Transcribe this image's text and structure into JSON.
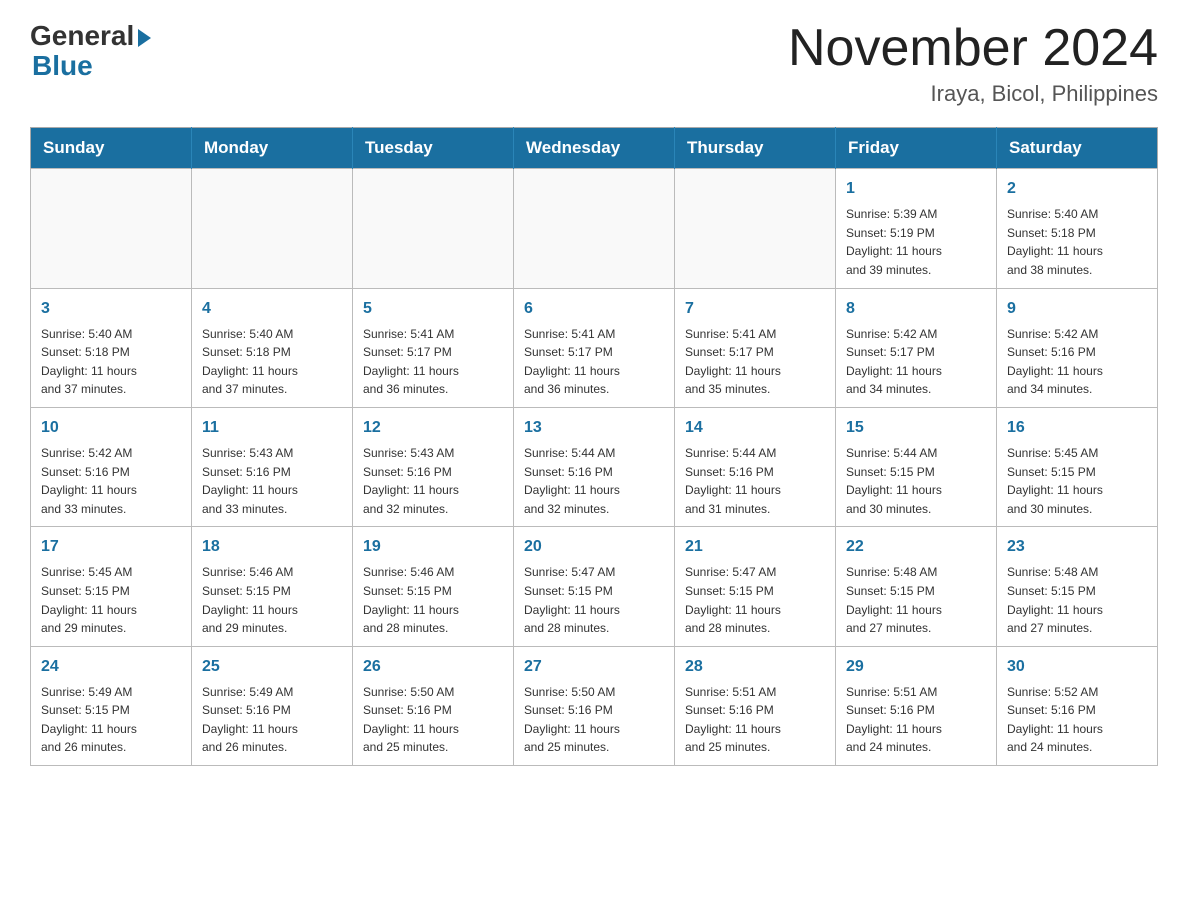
{
  "header": {
    "logo_general": "General",
    "logo_blue": "Blue",
    "month_title": "November 2024",
    "location": "Iraya, Bicol, Philippines"
  },
  "weekdays": [
    "Sunday",
    "Monday",
    "Tuesday",
    "Wednesday",
    "Thursday",
    "Friday",
    "Saturday"
  ],
  "weeks": [
    [
      {
        "day": "",
        "info": ""
      },
      {
        "day": "",
        "info": ""
      },
      {
        "day": "",
        "info": ""
      },
      {
        "day": "",
        "info": ""
      },
      {
        "day": "",
        "info": ""
      },
      {
        "day": "1",
        "info": "Sunrise: 5:39 AM\nSunset: 5:19 PM\nDaylight: 11 hours\nand 39 minutes."
      },
      {
        "day": "2",
        "info": "Sunrise: 5:40 AM\nSunset: 5:18 PM\nDaylight: 11 hours\nand 38 minutes."
      }
    ],
    [
      {
        "day": "3",
        "info": "Sunrise: 5:40 AM\nSunset: 5:18 PM\nDaylight: 11 hours\nand 37 minutes."
      },
      {
        "day": "4",
        "info": "Sunrise: 5:40 AM\nSunset: 5:18 PM\nDaylight: 11 hours\nand 37 minutes."
      },
      {
        "day": "5",
        "info": "Sunrise: 5:41 AM\nSunset: 5:17 PM\nDaylight: 11 hours\nand 36 minutes."
      },
      {
        "day": "6",
        "info": "Sunrise: 5:41 AM\nSunset: 5:17 PM\nDaylight: 11 hours\nand 36 minutes."
      },
      {
        "day": "7",
        "info": "Sunrise: 5:41 AM\nSunset: 5:17 PM\nDaylight: 11 hours\nand 35 minutes."
      },
      {
        "day": "8",
        "info": "Sunrise: 5:42 AM\nSunset: 5:17 PM\nDaylight: 11 hours\nand 34 minutes."
      },
      {
        "day": "9",
        "info": "Sunrise: 5:42 AM\nSunset: 5:16 PM\nDaylight: 11 hours\nand 34 minutes."
      }
    ],
    [
      {
        "day": "10",
        "info": "Sunrise: 5:42 AM\nSunset: 5:16 PM\nDaylight: 11 hours\nand 33 minutes."
      },
      {
        "day": "11",
        "info": "Sunrise: 5:43 AM\nSunset: 5:16 PM\nDaylight: 11 hours\nand 33 minutes."
      },
      {
        "day": "12",
        "info": "Sunrise: 5:43 AM\nSunset: 5:16 PM\nDaylight: 11 hours\nand 32 minutes."
      },
      {
        "day": "13",
        "info": "Sunrise: 5:44 AM\nSunset: 5:16 PM\nDaylight: 11 hours\nand 32 minutes."
      },
      {
        "day": "14",
        "info": "Sunrise: 5:44 AM\nSunset: 5:16 PM\nDaylight: 11 hours\nand 31 minutes."
      },
      {
        "day": "15",
        "info": "Sunrise: 5:44 AM\nSunset: 5:15 PM\nDaylight: 11 hours\nand 30 minutes."
      },
      {
        "day": "16",
        "info": "Sunrise: 5:45 AM\nSunset: 5:15 PM\nDaylight: 11 hours\nand 30 minutes."
      }
    ],
    [
      {
        "day": "17",
        "info": "Sunrise: 5:45 AM\nSunset: 5:15 PM\nDaylight: 11 hours\nand 29 minutes."
      },
      {
        "day": "18",
        "info": "Sunrise: 5:46 AM\nSunset: 5:15 PM\nDaylight: 11 hours\nand 29 minutes."
      },
      {
        "day": "19",
        "info": "Sunrise: 5:46 AM\nSunset: 5:15 PM\nDaylight: 11 hours\nand 28 minutes."
      },
      {
        "day": "20",
        "info": "Sunrise: 5:47 AM\nSunset: 5:15 PM\nDaylight: 11 hours\nand 28 minutes."
      },
      {
        "day": "21",
        "info": "Sunrise: 5:47 AM\nSunset: 5:15 PM\nDaylight: 11 hours\nand 28 minutes."
      },
      {
        "day": "22",
        "info": "Sunrise: 5:48 AM\nSunset: 5:15 PM\nDaylight: 11 hours\nand 27 minutes."
      },
      {
        "day": "23",
        "info": "Sunrise: 5:48 AM\nSunset: 5:15 PM\nDaylight: 11 hours\nand 27 minutes."
      }
    ],
    [
      {
        "day": "24",
        "info": "Sunrise: 5:49 AM\nSunset: 5:15 PM\nDaylight: 11 hours\nand 26 minutes."
      },
      {
        "day": "25",
        "info": "Sunrise: 5:49 AM\nSunset: 5:16 PM\nDaylight: 11 hours\nand 26 minutes."
      },
      {
        "day": "26",
        "info": "Sunrise: 5:50 AM\nSunset: 5:16 PM\nDaylight: 11 hours\nand 25 minutes."
      },
      {
        "day": "27",
        "info": "Sunrise: 5:50 AM\nSunset: 5:16 PM\nDaylight: 11 hours\nand 25 minutes."
      },
      {
        "day": "28",
        "info": "Sunrise: 5:51 AM\nSunset: 5:16 PM\nDaylight: 11 hours\nand 25 minutes."
      },
      {
        "day": "29",
        "info": "Sunrise: 5:51 AM\nSunset: 5:16 PM\nDaylight: 11 hours\nand 24 minutes."
      },
      {
        "day": "30",
        "info": "Sunrise: 5:52 AM\nSunset: 5:16 PM\nDaylight: 11 hours\nand 24 minutes."
      }
    ]
  ]
}
